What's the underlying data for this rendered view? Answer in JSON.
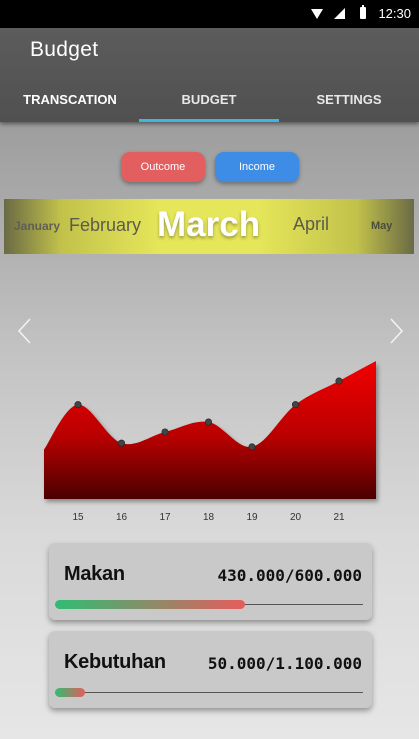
{
  "status_bar": {
    "time": "12:30",
    "icons": [
      "wifi-icon",
      "signal-icon",
      "battery-icon"
    ]
  },
  "app_title": "Budget",
  "tabs": [
    {
      "label": "TRANSCATION"
    },
    {
      "label": "BUDGET",
      "selected": true
    },
    {
      "label": "SETTINGS"
    }
  ],
  "toggle": {
    "outcome": "Outcome",
    "income": "Income"
  },
  "months": {
    "prev2": "January",
    "prev1": "February",
    "current": "March",
    "next1": "April",
    "next2": "May"
  },
  "colors": {
    "accent": "#3fb6df",
    "outcome": "#e35e5e",
    "income": "#3d8ce6",
    "chart_fill": "#cc0000"
  },
  "chart_data": {
    "type": "area",
    "x": [
      15,
      16,
      17,
      18,
      19,
      20,
      21
    ],
    "values": [
      0.76,
      0.45,
      0.54,
      0.62,
      0.42,
      0.76,
      0.95
    ],
    "tick_labels": [
      "15",
      "16",
      "17",
      "18",
      "19",
      "20",
      "21"
    ],
    "ylim": [
      0,
      1.2
    ],
    "grid": false
  },
  "budgets": [
    {
      "name": "Makan",
      "amount": "430.000/600.000",
      "progress": 0.717
    },
    {
      "name": "Kebutuhan",
      "amount": "50.000/1.100.000",
      "progress": 0.045
    }
  ]
}
